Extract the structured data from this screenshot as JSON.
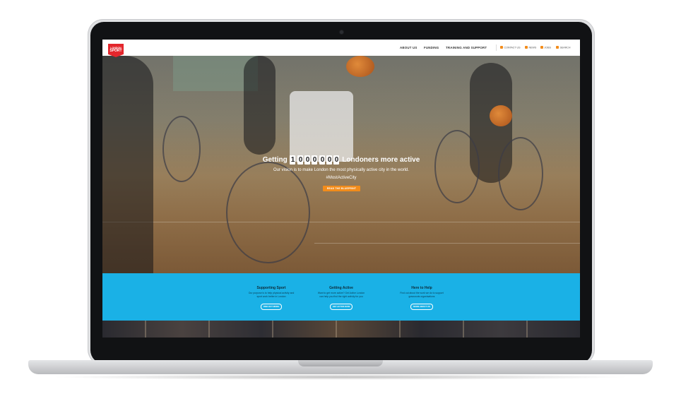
{
  "logo": {
    "line1": "LONDON",
    "line2": "SPORT"
  },
  "nav": {
    "main": [
      "ABOUT US",
      "FUNDING",
      "TRAINING AND SUPPORT"
    ],
    "utility": [
      "CONTACT US",
      "NEWS",
      "JOBS",
      "SEARCH"
    ]
  },
  "hero": {
    "headline_before": "Getting",
    "digits": [
      "1",
      "0",
      "0",
      "0",
      "0",
      "0",
      "0"
    ],
    "headline_after": "Londoners more active",
    "vision": "Our vision is to make London the most physically active city in the world.",
    "hashtag": "#MostActiveCity",
    "cta_label": "READ THE BLUEPRINT"
  },
  "columns": [
    {
      "title": "Supporting Sport",
      "text1": "Our purpose is to help physical activity and",
      "text2": "sport work better in London",
      "button": "FIND OUT MORE"
    },
    {
      "title": "Getting Active",
      "text1": "Want to get more active? Get Active London",
      "text2": "can help you find the right activity for you",
      "button": "GET ACTIVE NOW"
    },
    {
      "title": "Here to Help",
      "text1": "Find out about the work we do to support",
      "text2": "grassroots organisations",
      "button": "MORE ABOUT US"
    }
  ],
  "colors": {
    "brand_red": "#e3262c",
    "accent_orange": "#f28c1b",
    "band_blue": "#1ab1e6"
  }
}
